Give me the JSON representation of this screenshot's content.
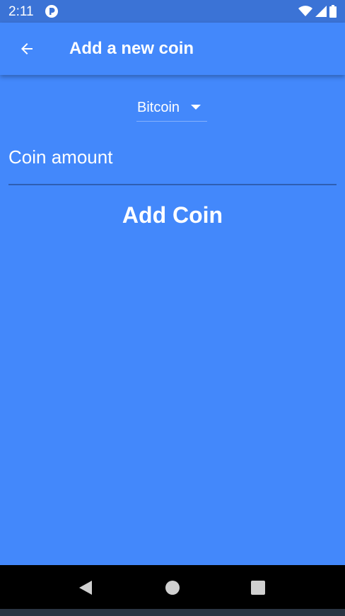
{
  "status_bar": {
    "time": "2:11",
    "icons": [
      "app-notification-icon",
      "wifi-icon",
      "cell-signal-icon",
      "battery-icon"
    ]
  },
  "app_bar": {
    "title": "Add a new coin",
    "back_icon": "arrow-left-icon"
  },
  "form": {
    "coin_dropdown": {
      "selected": "Bitcoin",
      "icon": "caret-down-icon"
    },
    "amount_field": {
      "placeholder": "Coin amount",
      "value": ""
    },
    "submit_label": "Add Coin"
  },
  "nav_bar": {
    "buttons": [
      "nav-back-icon",
      "nav-home-icon",
      "nav-recents-icon"
    ]
  },
  "colors": {
    "background": "#4388fb",
    "status_bar": "#3b73d6",
    "text": "#ffffff",
    "nav_bar": "#000000"
  }
}
